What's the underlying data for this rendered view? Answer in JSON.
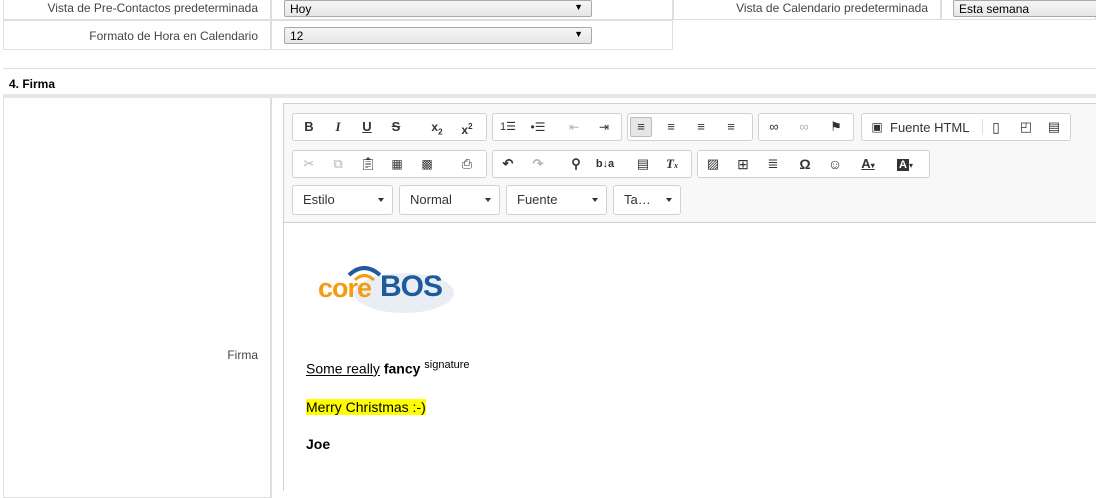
{
  "settings": {
    "precontacts_view_label": "Vista de Pre-Contactos predeterminada",
    "precontacts_view_value": "Hoy",
    "calendar_view_label": "Vista de Calendario predeterminada",
    "calendar_view_value": "Esta semana",
    "hour_format_label": "Formato de Hora en Calendario",
    "hour_format_value": "12"
  },
  "section": {
    "title": "4. Firma"
  },
  "signature_field": {
    "label": "Firma"
  },
  "toolbar": {
    "source_label": "Fuente HTML",
    "combos": {
      "style": "Estilo",
      "format": "Normal",
      "font": "Fuente",
      "size": "Ta…"
    },
    "icons": [
      "bold-icon",
      "italic-icon",
      "underline-icon",
      "strikethrough-icon",
      "subscript-icon",
      "superscript-icon",
      "numbered-list-icon",
      "bulleted-list-icon",
      "outdent-icon",
      "indent-icon",
      "align-left-icon",
      "align-center-icon",
      "align-right-icon",
      "justify-icon",
      "link-icon",
      "unlink-icon",
      "anchor-icon",
      "source-icon",
      "new-page-icon",
      "preview-icon",
      "templates-icon",
      "cut-icon",
      "copy-icon",
      "paste-icon",
      "paste-text-icon",
      "paste-word-icon",
      "print-icon",
      "undo-icon",
      "redo-icon",
      "find-icon",
      "replace-icon",
      "select-all-icon",
      "remove-format-icon",
      "image-icon",
      "table-icon",
      "horizontal-rule-icon",
      "special-char-icon",
      "smiley-icon",
      "text-color-icon",
      "bg-color-icon"
    ]
  },
  "content": {
    "logo_text_core": "core",
    "logo_text_bos": "BOS",
    "line1_underlined": "Some really",
    "line1_bold": "fancy",
    "line1_sup": "signature",
    "line2_highlight": "Merry Christmas :-)",
    "line3_bold": "Joe"
  },
  "colors": {
    "highlight": "#ffff00",
    "logo_orange": "#f39c12",
    "logo_blue": "#1e5a9e"
  }
}
